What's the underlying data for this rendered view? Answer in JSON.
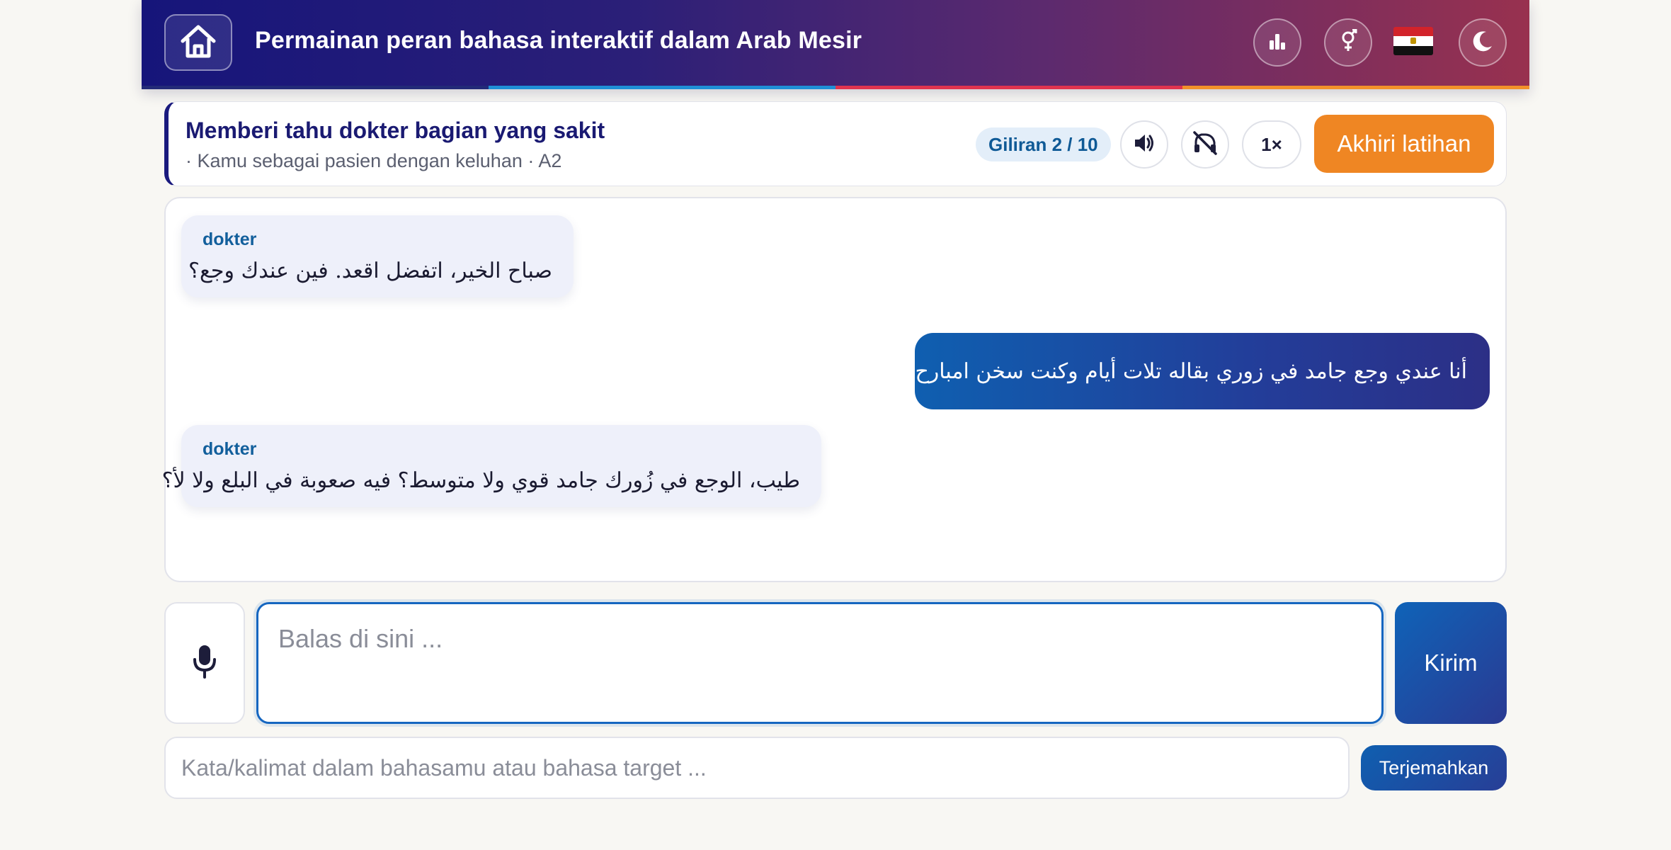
{
  "header": {
    "title": "Permainan peran bahasa interaktif dalam Arab Mesir",
    "home_icon": "home-icon",
    "stats_icon": "bar-chart-icon",
    "gender_icon": "gender-icon",
    "flag": "egypt-flag",
    "theme_icon": "moon-icon",
    "progress_colors": [
      "#232a78",
      "#1f8fd6",
      "#e0344f",
      "#f2912a"
    ]
  },
  "scenario": {
    "title": "Memberi tahu dokter bagian yang sakit",
    "subtitle": "· Kamu sebagai pasien dengan keluhan · A2",
    "turn": "Giliran 2 / 10",
    "speaker_icon": "speaker-icon",
    "mute_icon": "audio-off-icon",
    "speed": "1×",
    "end_label": "Akhiri latihan"
  },
  "chat": {
    "messages": [
      {
        "role": "bot",
        "speaker": "dokter",
        "text": "صباح الخير، اتفضل اقعد. فين عندك وجع؟"
      },
      {
        "role": "user",
        "text": "أنا عندي وجع جامد في زوري بقاله تلات أيام وكنت سخن امبارح."
      },
      {
        "role": "bot",
        "speaker": "dokter",
        "text": "طيب، الوجع في زُورك جامد قوي ولا متوسط؟ فيه صعوبة في البلع ولا لأ؟"
      }
    ]
  },
  "input": {
    "mic_icon": "microphone-icon",
    "reply_placeholder": "Balas di sini ...",
    "reply_value": "",
    "send_label": "Kirim",
    "translate_placeholder": "Kata/kalimat dalam bahasamu atau bahasa target ...",
    "translate_value": "",
    "translate_label": "Terjemahkan"
  }
}
